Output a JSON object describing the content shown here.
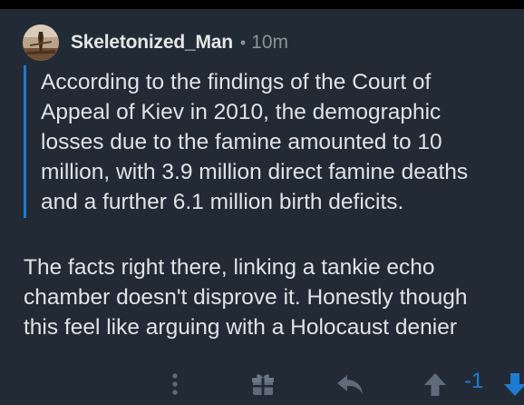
{
  "post": {
    "username": "Skeletonized_Man",
    "separator": "•",
    "time": "10m",
    "quote_lines": [
      "According to the findings of the Court of",
      "Appeal of Kiev in 2010, the demographic",
      "losses due to the famine amounted to 10",
      "million, with 3.9 million direct famine deaths",
      "and a further 6.1 million birth deficits."
    ],
    "body_lines": [
      "The facts right there, linking a tankie echo",
      "chamber doesn't disprove it. Honestly though",
      "this feel like arguing with a Holocaust denier"
    ]
  },
  "actions": {
    "score": "-1",
    "icons": [
      "more-vertical-icon",
      "gift-icon",
      "reply-icon",
      "upvote-icon",
      "downvote-icon"
    ]
  },
  "colors": {
    "background": "#222b35",
    "accent": "#1e7bd3",
    "text": "#dfe3e8",
    "muted": "#8a9199"
  }
}
